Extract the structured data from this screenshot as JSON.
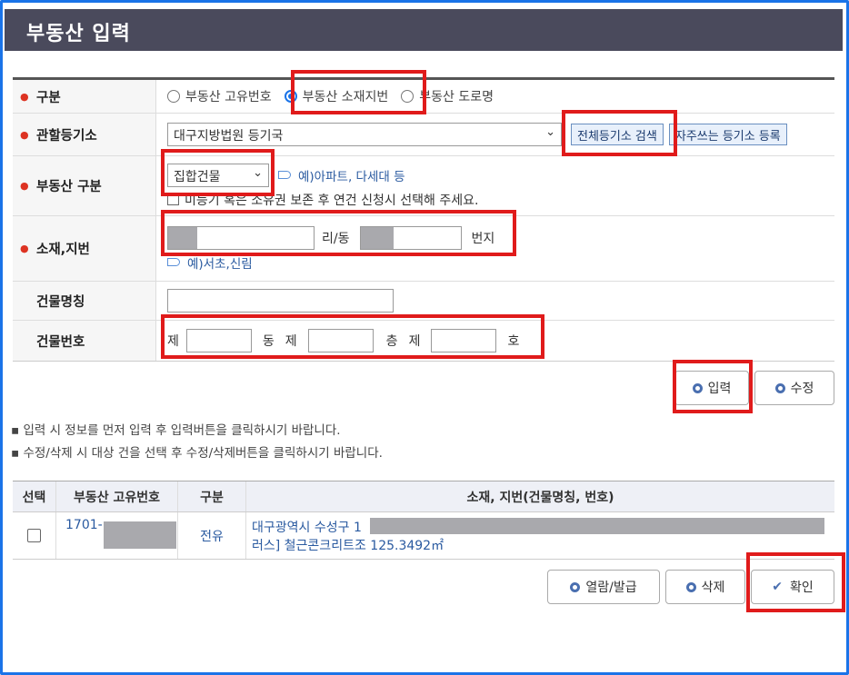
{
  "title": "부동산 입력",
  "form": {
    "type_label": "구분",
    "type_options": [
      "부동산 고유번호",
      "부동산 소재지번",
      "부동산 도로명"
    ],
    "type_selected": "부동산 소재지번",
    "registry_label": "관할등기소",
    "registry_value": "대구지방법원 등기국",
    "search_all_button": "전체등기소 검색",
    "register_favorite_button": "자주쓰는 등기소 등록",
    "property_type_label": "부동산 구분",
    "property_type_value": "집합건물",
    "property_type_hint": "예)아파트, 다세대 등",
    "unregistered_checkbox": "미등기 혹은 소유권 보존 후 연건 신청시 선택해 주세요.",
    "address_label": "소재,지번",
    "address_ri_dong": "리/동",
    "address_beonji": "번지",
    "address_hint": "예)서초,신림",
    "building_name_label": "건물명칭",
    "building_number_label": "건물번호",
    "bn_je1": "제",
    "bn_dong": "동",
    "bn_je2": "제",
    "bn_cheung": "층",
    "bn_je3": "제",
    "bn_ho": "호"
  },
  "buttons": {
    "input": "입력",
    "edit": "수정",
    "view_issue": "열람/발급",
    "delete": "삭제",
    "confirm": "확인"
  },
  "notes": [
    "▪ 입력 시 정보를 먼저 입력 후 입력버튼을 클릭하시기 바랍니다.",
    "▪ 수정/삭제 시 대상 건을 선택 후 수정/삭제버튼을 클릭하시기 바랍니다."
  ],
  "table": {
    "headers": [
      "선택",
      "부동산 고유번호",
      "구분",
      "소재, 지번(건물명칭, 번호)"
    ],
    "rows": [
      {
        "id": "1701-",
        "type": "전유",
        "address_line1": "대구광역시 수성구 1",
        "address_line2": "러스] 철근콘크리트조 125.3492㎡"
      }
    ]
  },
  "colors": {
    "accent": "#1a73e8",
    "title_bg": "#4a4a5c",
    "highlight": "#e01b1b"
  }
}
